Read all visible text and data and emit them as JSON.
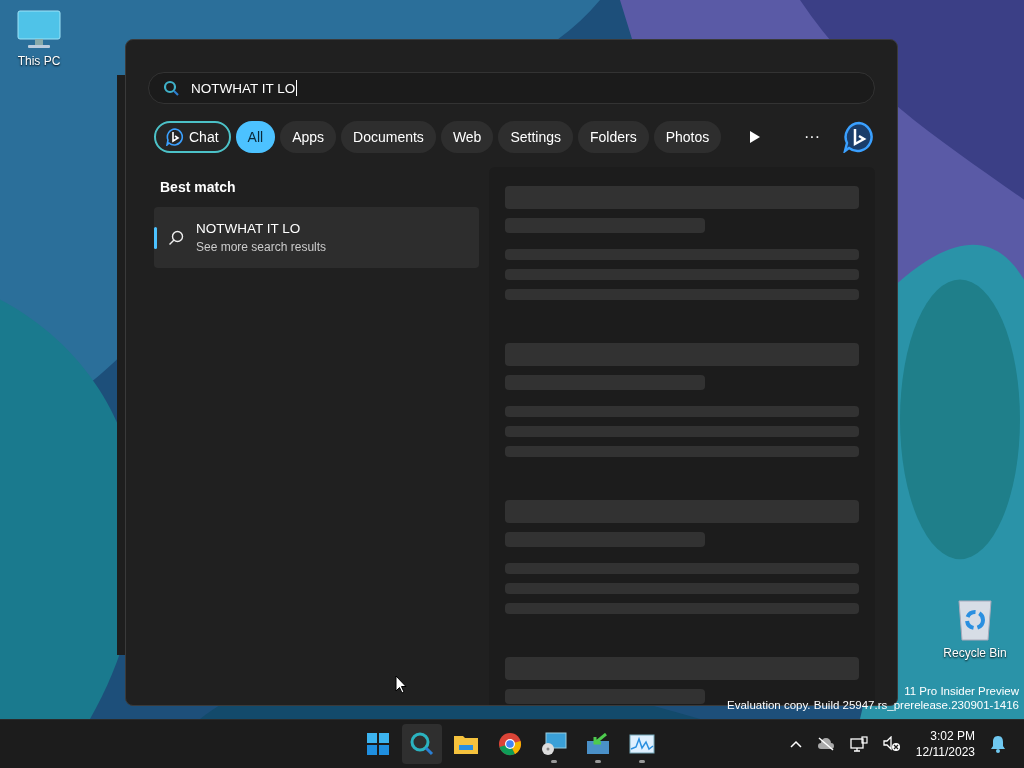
{
  "desktop_icons": [
    {
      "kind": "pc",
      "label": "This PC"
    },
    {
      "kind": "bin",
      "label": "Recycle Bin"
    }
  ],
  "search": {
    "value": "NOTWHAT IT LO"
  },
  "filters": [
    {
      "kind": "bing",
      "label": "Chat",
      "selected": false
    },
    {
      "kind": "chip",
      "label": "All",
      "selected": true
    },
    {
      "kind": "chip",
      "label": "Apps",
      "selected": false
    },
    {
      "kind": "chip",
      "label": "Documents",
      "selected": false
    },
    {
      "kind": "chip",
      "label": "Web",
      "selected": false
    },
    {
      "kind": "chip",
      "label": "Settings",
      "selected": false
    },
    {
      "kind": "chip",
      "label": "Folders",
      "selected": false
    },
    {
      "kind": "chip",
      "label": "Photos",
      "selected": false
    }
  ],
  "more_button": "···",
  "best_match": {
    "heading": "Best match",
    "title": "NOTWHAT IT LO",
    "subtitle": "See more search results",
    "selected": true
  },
  "watermark": [
    "11 Pro Insider Preview",
    "Evaluation copy. Build 25947.rs_prerelease.230901-1416"
  ],
  "taskbar": [
    {
      "kind": "start",
      "selected": false,
      "running": false
    },
    {
      "kind": "search",
      "selected": true,
      "running": false
    },
    {
      "kind": "explorer",
      "selected": false,
      "running": false
    },
    {
      "kind": "chrome",
      "selected": false,
      "running": false
    },
    {
      "kind": "remote",
      "selected": false,
      "running": true
    },
    {
      "kind": "installer",
      "selected": false,
      "running": true
    },
    {
      "kind": "monitor",
      "selected": false,
      "running": true
    }
  ],
  "clock": {
    "time": "3:02 PM",
    "date": "12/11/2023"
  }
}
